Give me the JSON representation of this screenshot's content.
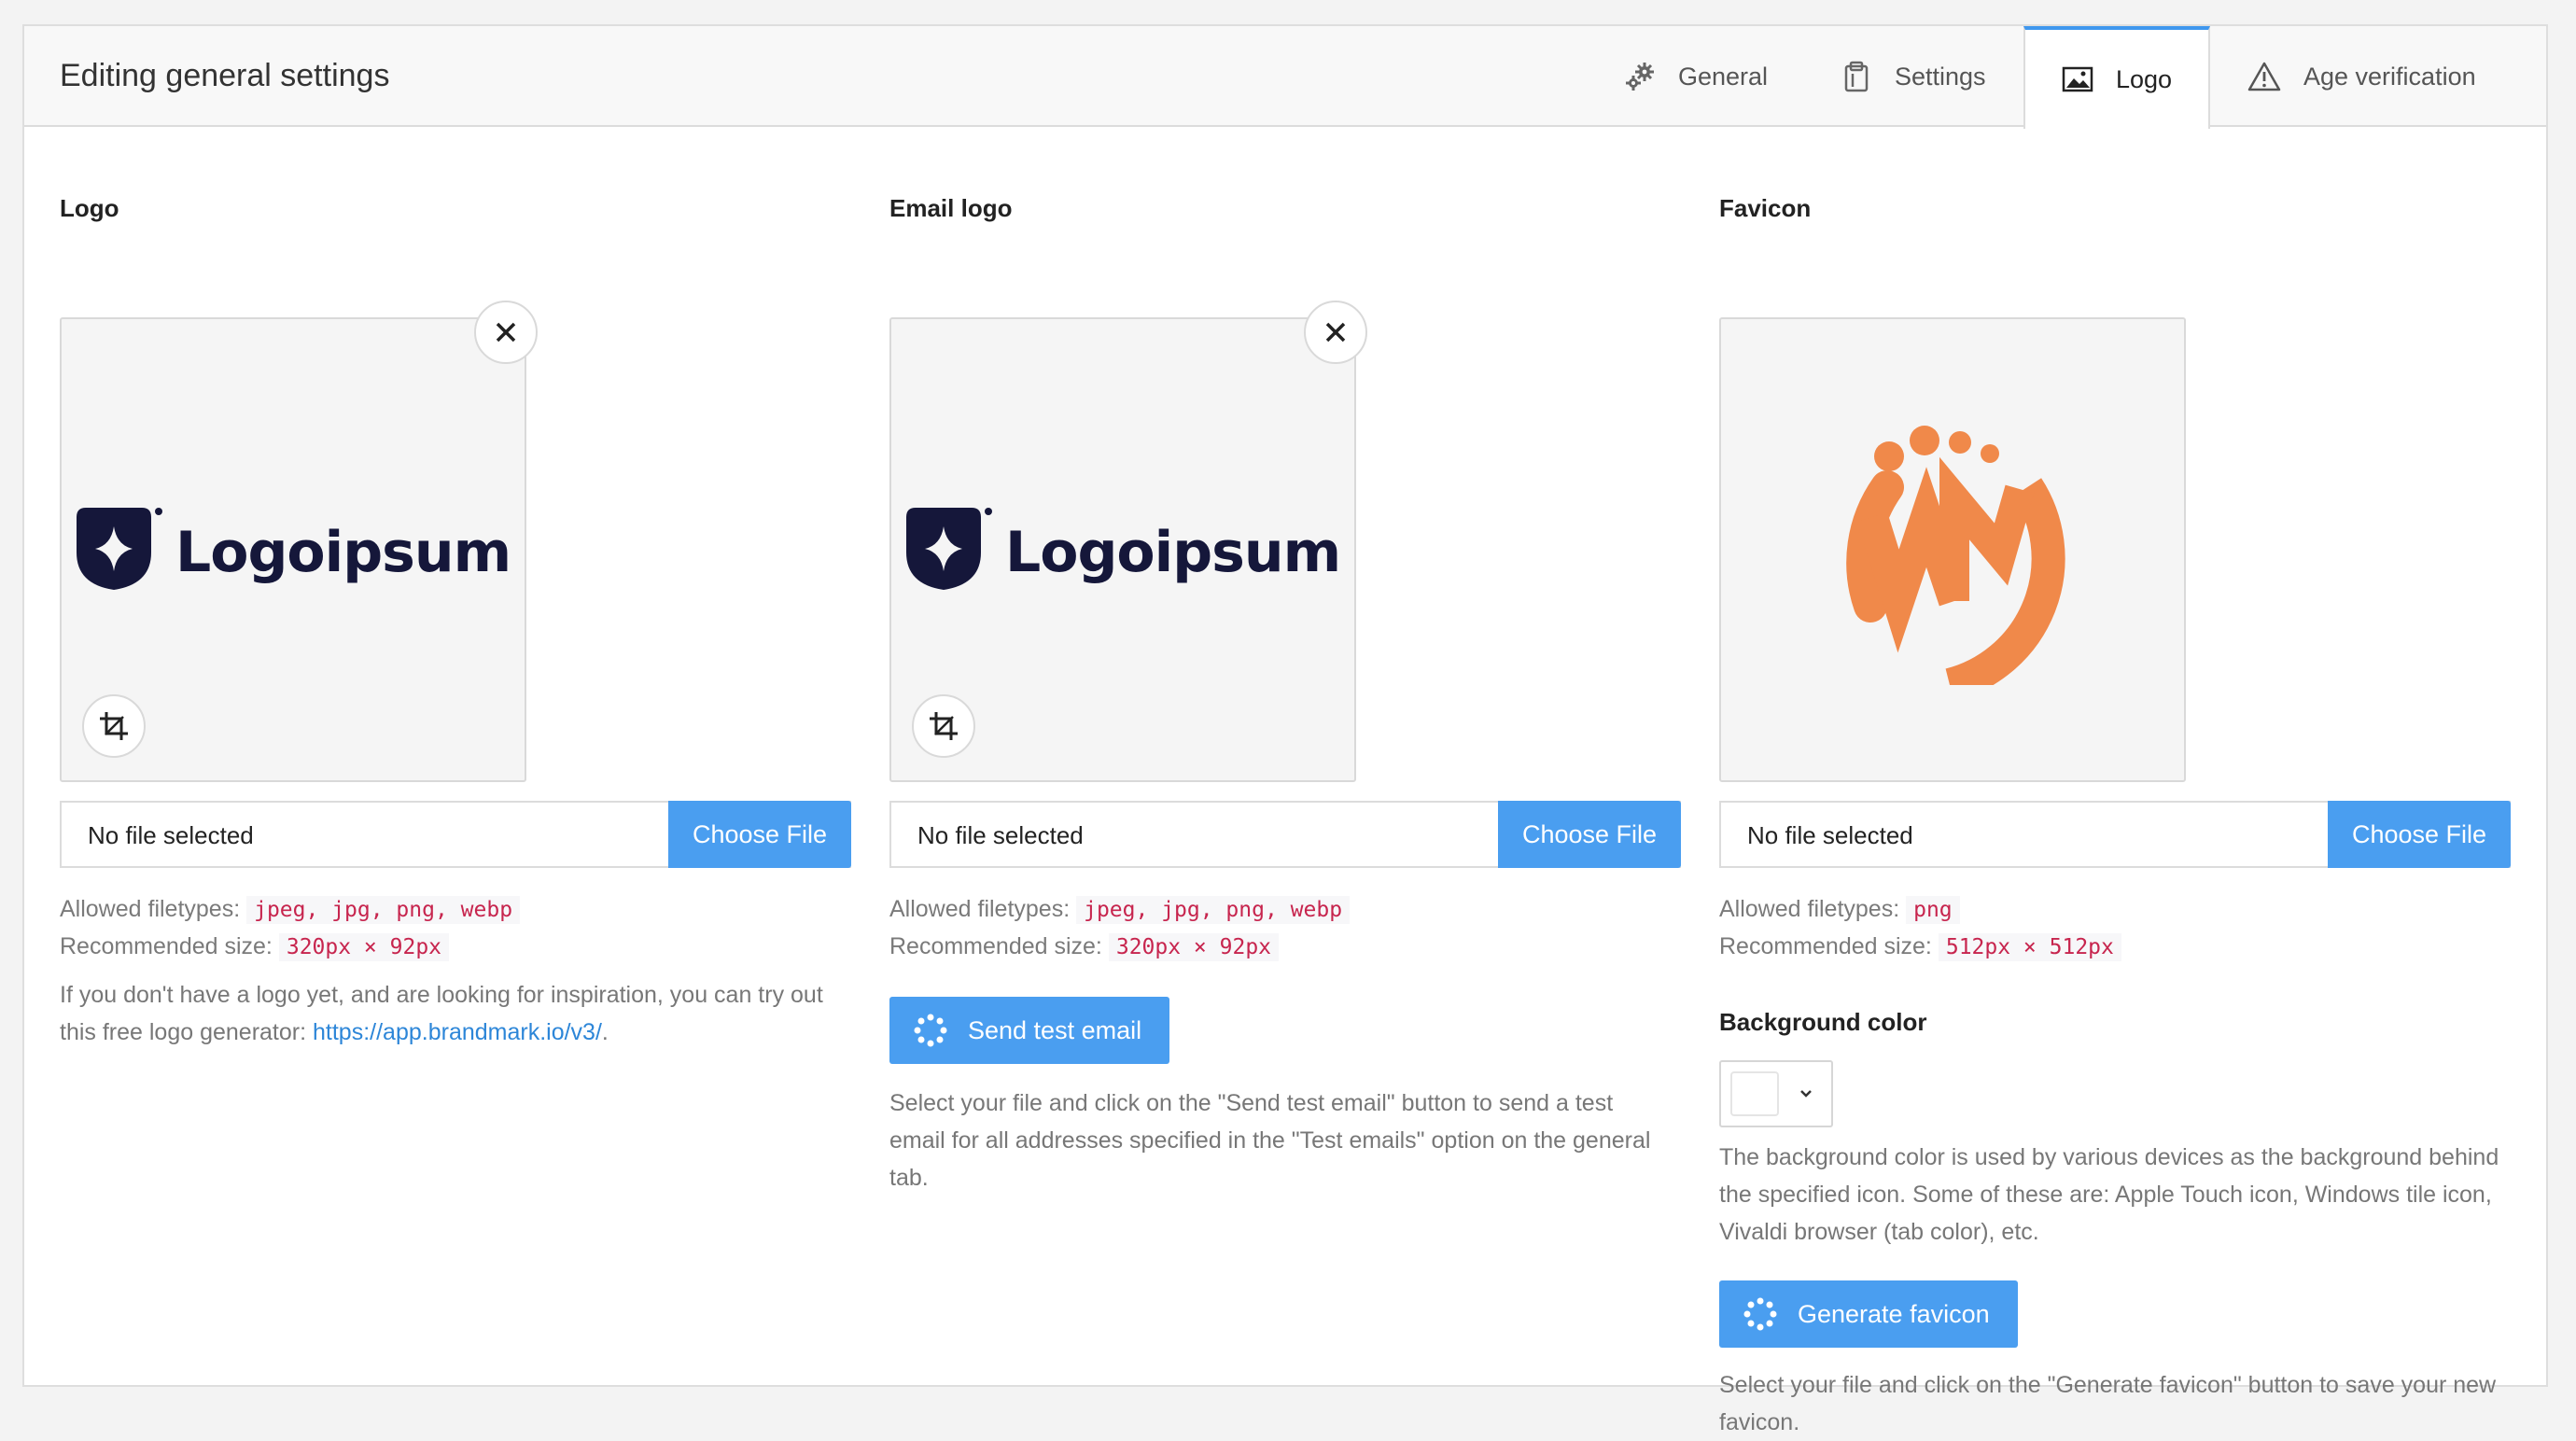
{
  "header": {
    "title": "Editing general settings",
    "tabs": [
      {
        "label": "General",
        "icon": "gears-icon"
      },
      {
        "label": "Settings",
        "icon": "clipboard-icon"
      },
      {
        "label": "Logo",
        "icon": "image-icon",
        "active": true
      },
      {
        "label": "Age verification",
        "icon": "warning-icon"
      }
    ]
  },
  "logo": {
    "title": "Logo",
    "brand_text": "Logoipsum",
    "file_status": "No file selected",
    "choose_label": "Choose File",
    "filetypes_label": "Allowed filetypes:",
    "filetypes": "jpeg, jpg, png, webp",
    "size_label": "Recommended size:",
    "size": "320px × 92px",
    "help_text": "If you don't have a logo yet, and are looking for inspiration, you can try out this free logo generator:",
    "help_link": "https://app.brandmark.io/v3/",
    "help_end": "."
  },
  "email_logo": {
    "title": "Email logo",
    "brand_text": "Logoipsum",
    "file_status": "No file selected",
    "choose_label": "Choose File",
    "filetypes_label": "Allowed filetypes:",
    "filetypes": "jpeg, jpg, png, webp",
    "size_label": "Recommended size:",
    "size": "320px × 92px",
    "send_button": "Send test email",
    "help_text": "Select your file and click on the \"Send test email\" button to send a test email for all addresses specified in the \"Test emails\" option on the general tab."
  },
  "favicon": {
    "title": "Favicon",
    "file_status": "No file selected",
    "choose_label": "Choose File",
    "filetypes_label": "Allowed filetypes:",
    "filetypes": "png",
    "size_label": "Recommended size:",
    "size": "512px × 512px",
    "bg_title": "Background color",
    "bg_color": "#ffffff",
    "bg_help": "The background color is used by various devices as the background behind the specified icon. Some of these are: Apple Touch icon, Windows tile icon, Vivaldi browser (tab color), etc.",
    "generate_button": "Generate favicon",
    "generate_help": "Select your file and click on the \"Generate favicon\" button to save your new favicon.",
    "brand_color": "#f0894a"
  },
  "colors": {
    "accent": "#4a9ef0",
    "code": "#c7254e",
    "logo_navy": "#15173a"
  }
}
